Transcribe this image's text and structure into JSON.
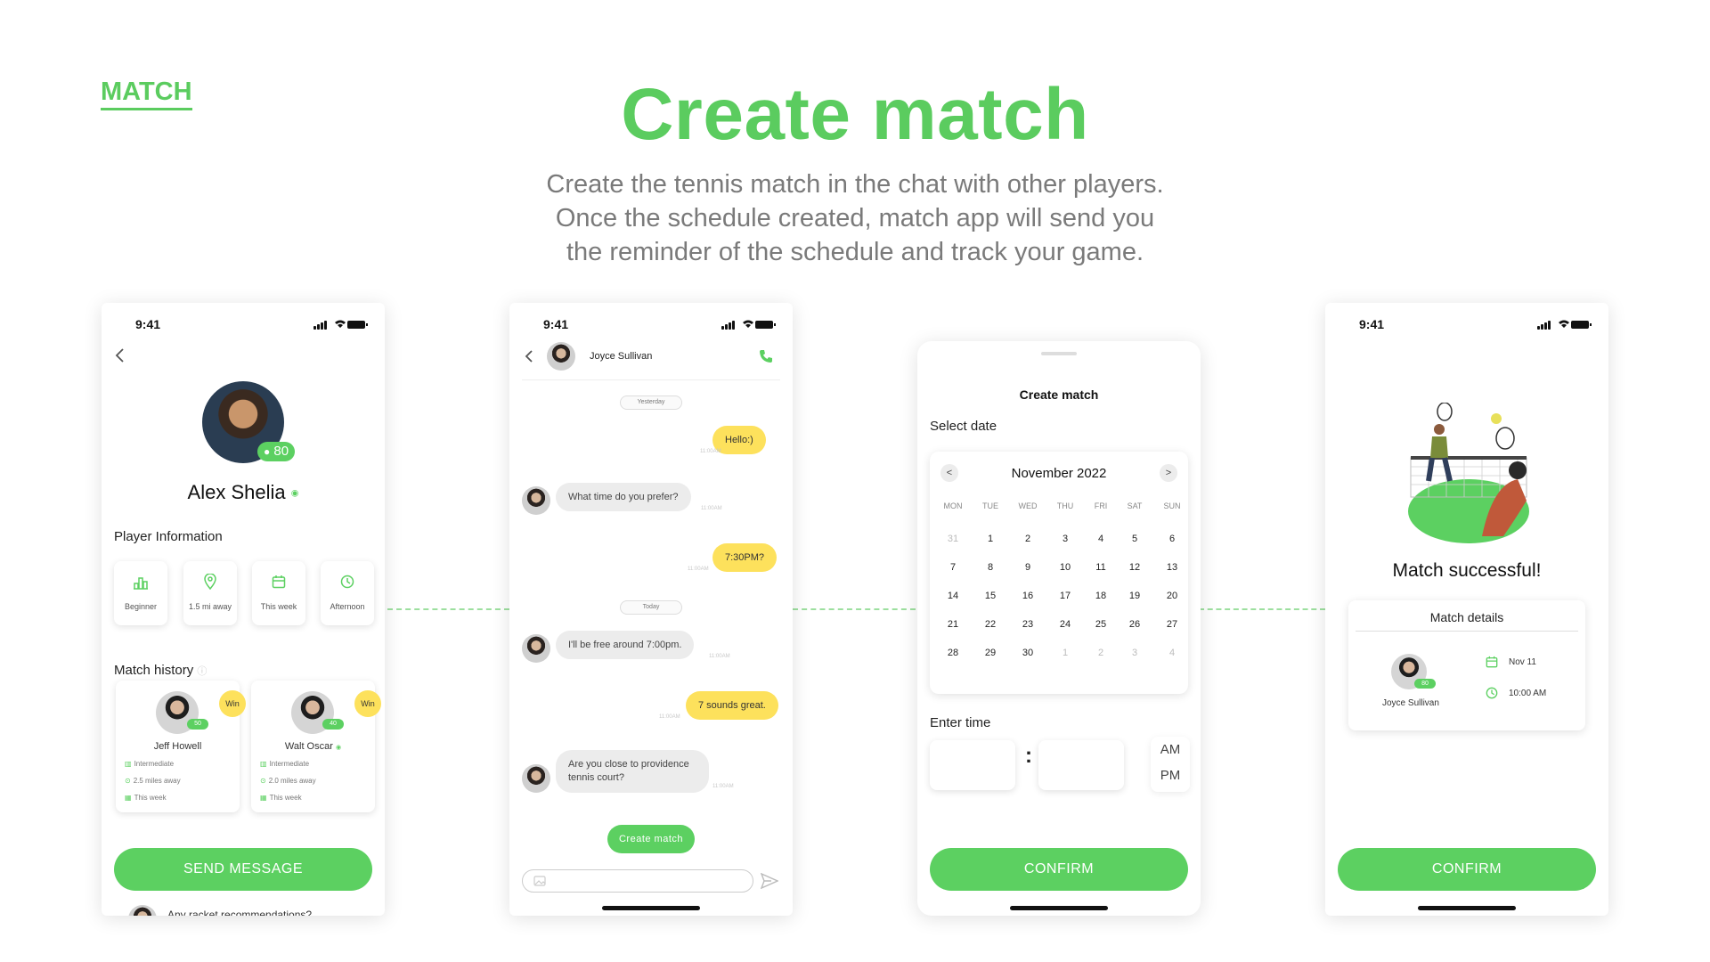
{
  "section_tag": "MATCH",
  "headline": "Create match",
  "description": [
    "Create the tennis match in the chat with other players.",
    "Once the schedule created, match app will send you",
    "the reminder of the schedule and track your game."
  ],
  "colors": {
    "accent": "#5cd061",
    "win_badge": "#fde15c",
    "out_bubble": "#fde15c",
    "in_bubble": "#ececec"
  },
  "status_time": "9:41",
  "profile": {
    "name": "Alex Shelia",
    "score": "80",
    "section_info": "Player Information",
    "info_cards": [
      {
        "icon": "bar-chart-icon",
        "label": "Beginner"
      },
      {
        "icon": "location-pin-icon",
        "label": "1.5 mi away"
      },
      {
        "icon": "calendar-icon",
        "label": "This week"
      },
      {
        "icon": "clock-icon",
        "label": "Afternoon"
      }
    ],
    "section_history": "Match history",
    "history": [
      {
        "name": "Jeff Howell",
        "badge": "Win",
        "score": "50",
        "level": "Intermediate",
        "distance": "2.5 miles away",
        "when": "This week"
      },
      {
        "name": "Walt Oscar",
        "badge": "Win",
        "score": "40",
        "level": "Intermediate",
        "distance": "2.0 miles away",
        "when": "This week"
      }
    ],
    "send_button": "SEND MESSAGE",
    "peek_text": "Any racket recommendations?"
  },
  "chat": {
    "contact": "Joyce Sullivan",
    "day1": "Yesterday",
    "day2": "Today",
    "stamp": "11:00AM",
    "messages": [
      {
        "dir": "out",
        "text": "Hello:)"
      },
      {
        "dir": "in",
        "text": "What time do you prefer?"
      },
      {
        "dir": "out",
        "text": "7:30PM?"
      },
      {
        "dir": "in",
        "text": "I'll be free around 7:00pm."
      },
      {
        "dir": "out",
        "text": "7 sounds great."
      },
      {
        "dir": "in",
        "text": [
          "Are you close to providence",
          "tennis court?"
        ]
      }
    ],
    "create_button": "Create match"
  },
  "create": {
    "title": "Create match",
    "select_date": "Select date",
    "month": "November 2022",
    "prev": "<",
    "next": ">",
    "weekdays": [
      "MON",
      "TUE",
      "WED",
      "THU",
      "FRI",
      "SAT",
      "SUN"
    ],
    "weeks": [
      [
        "31",
        "1",
        "2",
        "3",
        "4",
        "5",
        "6"
      ],
      [
        "7",
        "8",
        "9",
        "10",
        "11",
        "12",
        "13"
      ],
      [
        "14",
        "15",
        "16",
        "17",
        "18",
        "19",
        "20"
      ],
      [
        "21",
        "22",
        "23",
        "24",
        "25",
        "26",
        "27"
      ],
      [
        "28",
        "29",
        "30",
        "1",
        "2",
        "3",
        "4"
      ]
    ],
    "enter_time": "Enter time",
    "colon": ":",
    "am": "AM",
    "pm": "PM",
    "confirm": "CONFIRM"
  },
  "success": {
    "title": "Match successful!",
    "details_title": "Match details",
    "player": "Joyce Sullivan",
    "player_score": "80",
    "date": "Nov 11",
    "time": "10:00 AM",
    "confirm": "CONFIRM"
  }
}
